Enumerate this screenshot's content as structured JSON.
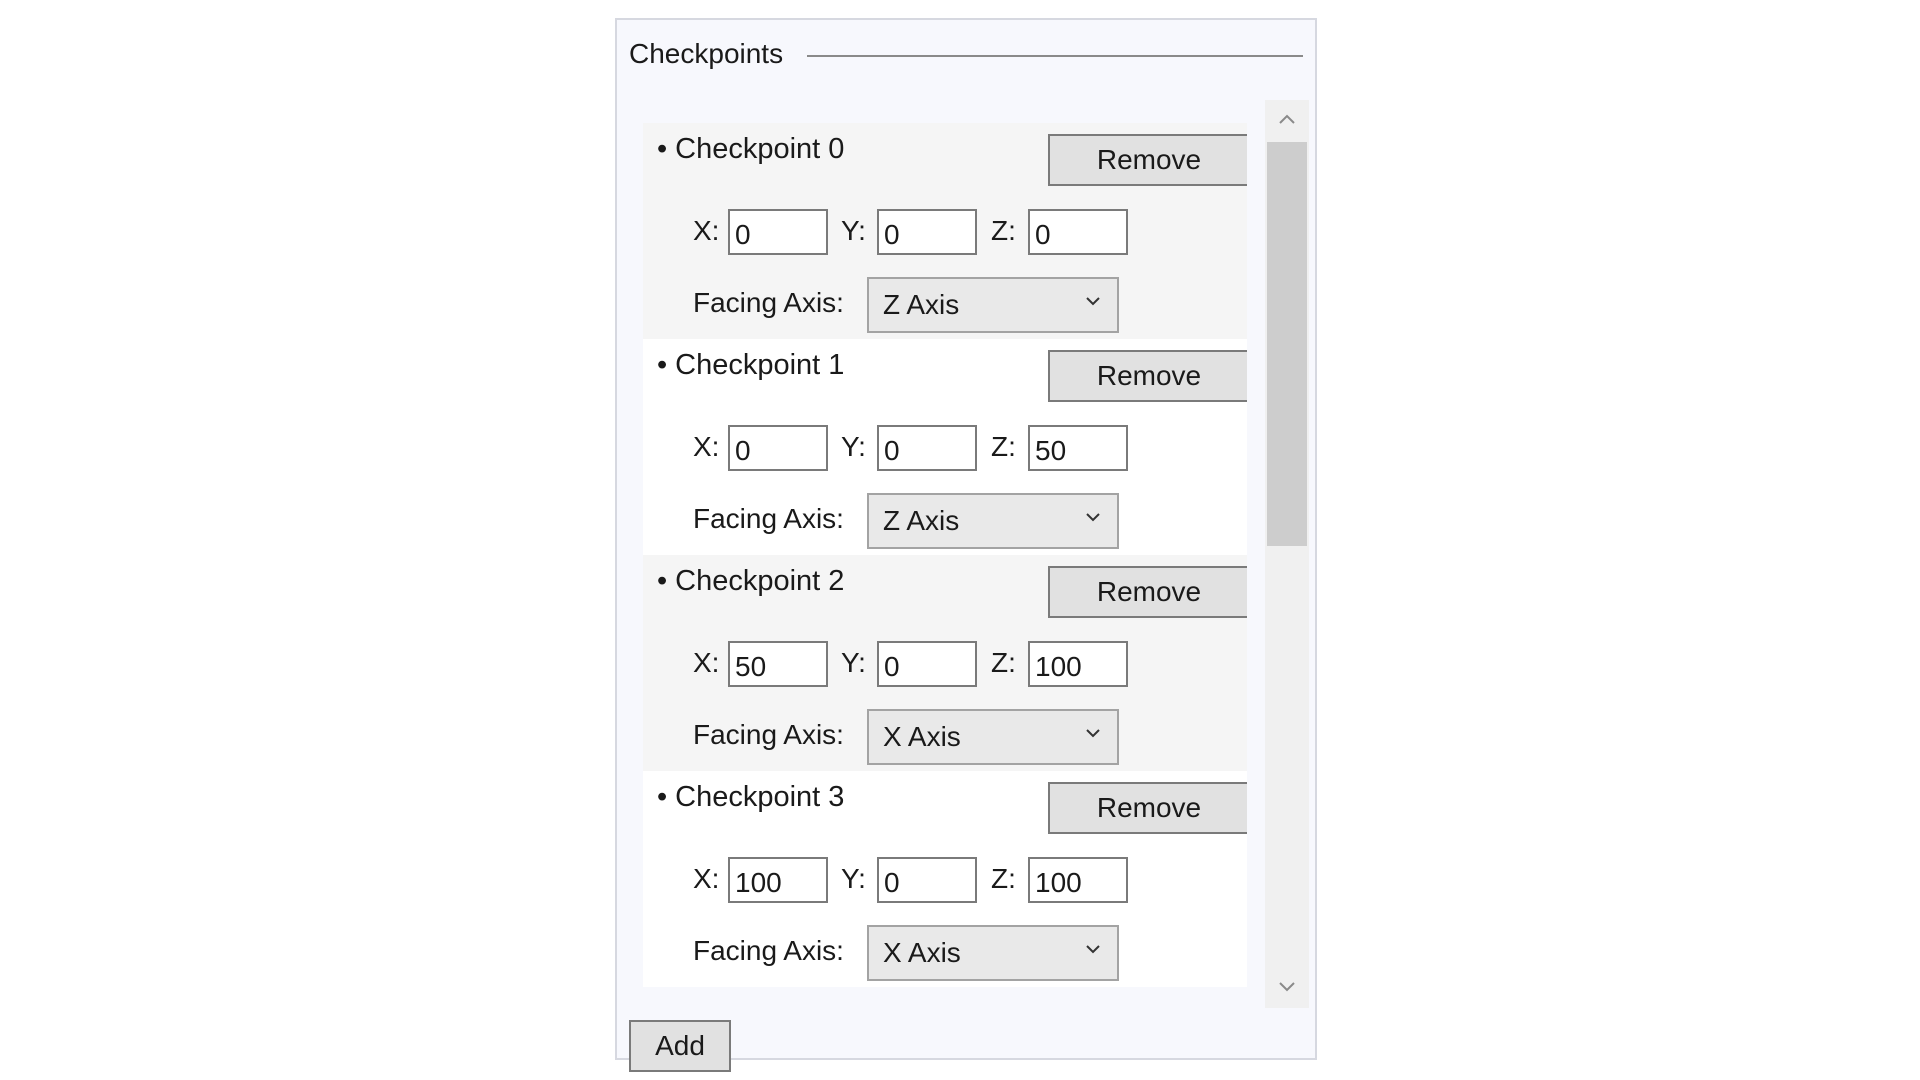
{
  "group": {
    "title": "Checkpoints"
  },
  "labels": {
    "x": "X:",
    "y": "Y:",
    "z": "Z:",
    "facing": "Facing Axis:",
    "remove": "Remove",
    "add": "Add",
    "bullet": "•"
  },
  "checkpoints": [
    {
      "name": "Checkpoint 0",
      "x": "0",
      "y": "0",
      "z": "0",
      "facing": "Z Axis"
    },
    {
      "name": "Checkpoint 1",
      "x": "0",
      "y": "0",
      "z": "50",
      "facing": "Z Axis"
    },
    {
      "name": "Checkpoint 2",
      "x": "50",
      "y": "0",
      "z": "100",
      "facing": "X Axis"
    },
    {
      "name": "Checkpoint 3",
      "x": "100",
      "y": "0",
      "z": "100",
      "facing": "X Axis"
    }
  ],
  "icons": {
    "scroll_up": "chevron-up-icon",
    "scroll_down": "chevron-down-icon",
    "dropdown": "chevron-down-icon"
  },
  "colors": {
    "panel_background": "#f7f8fd",
    "button_face": "#e1e1e1",
    "scroll_thumb": "#cdcdcd"
  }
}
